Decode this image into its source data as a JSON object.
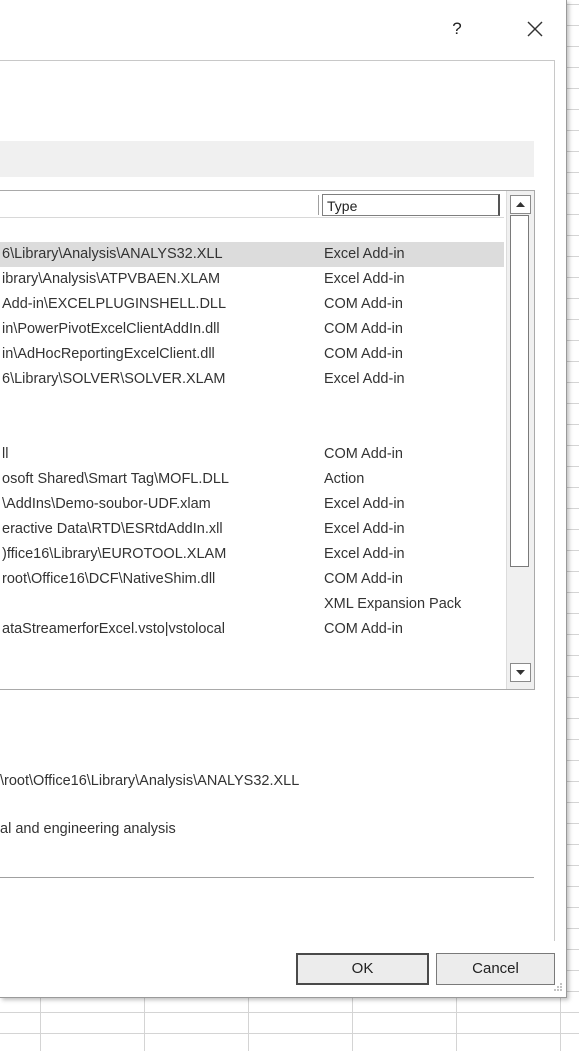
{
  "title_bar": {
    "help_label": "?",
    "close_icon": "close-icon"
  },
  "list": {
    "header_type": "Type",
    "rows": [
      {
        "path": "",
        "type": ""
      },
      {
        "path": "6\\Library\\Analysis\\ANALYS32.XLL",
        "type": "Excel Add-in",
        "selected": true
      },
      {
        "path": "ibrary\\Analysis\\ATPVBAEN.XLAM",
        "type": "Excel Add-in"
      },
      {
        "path": "Add-in\\EXCELPLUGINSHELL.DLL",
        "type": "COM Add-in"
      },
      {
        "path": "in\\PowerPivotExcelClientAddIn.dll",
        "type": "COM Add-in"
      },
      {
        "path": "in\\AdHocReportingExcelClient.dll",
        "type": "COM Add-in"
      },
      {
        "path": "6\\Library\\SOLVER\\SOLVER.XLAM",
        "type": "Excel Add-in"
      },
      {
        "path": "",
        "type": ""
      },
      {
        "path": "",
        "type": ""
      },
      {
        "path": "ll",
        "type": "COM Add-in"
      },
      {
        "path": "osoft Shared\\Smart Tag\\MOFL.DLL",
        "type": "Action"
      },
      {
        "path": "\\AddIns\\Demo-soubor-UDF.xlam",
        "type": "Excel Add-in"
      },
      {
        "path": "eractive Data\\RTD\\ESRtdAddIn.xll",
        "type": "Excel Add-in"
      },
      {
        "path": ")ffice16\\Library\\EUROTOOL.XLAM",
        "type": "Excel Add-in"
      },
      {
        "path": "root\\Office16\\DCF\\NativeShim.dll",
        "type": "COM Add-in"
      },
      {
        "path": "",
        "type": "XML Expansion Pack"
      },
      {
        "path": "ataStreamerforExcel.vsto|vstolocal",
        "type": "COM Add-in"
      }
    ]
  },
  "details": {
    "location": "\\root\\Office16\\Library\\Analysis\\ANALYS32.XLL",
    "description": "al and engineering analysis"
  },
  "buttons": {
    "ok_label": "OK",
    "cancel_label": "Cancel"
  }
}
